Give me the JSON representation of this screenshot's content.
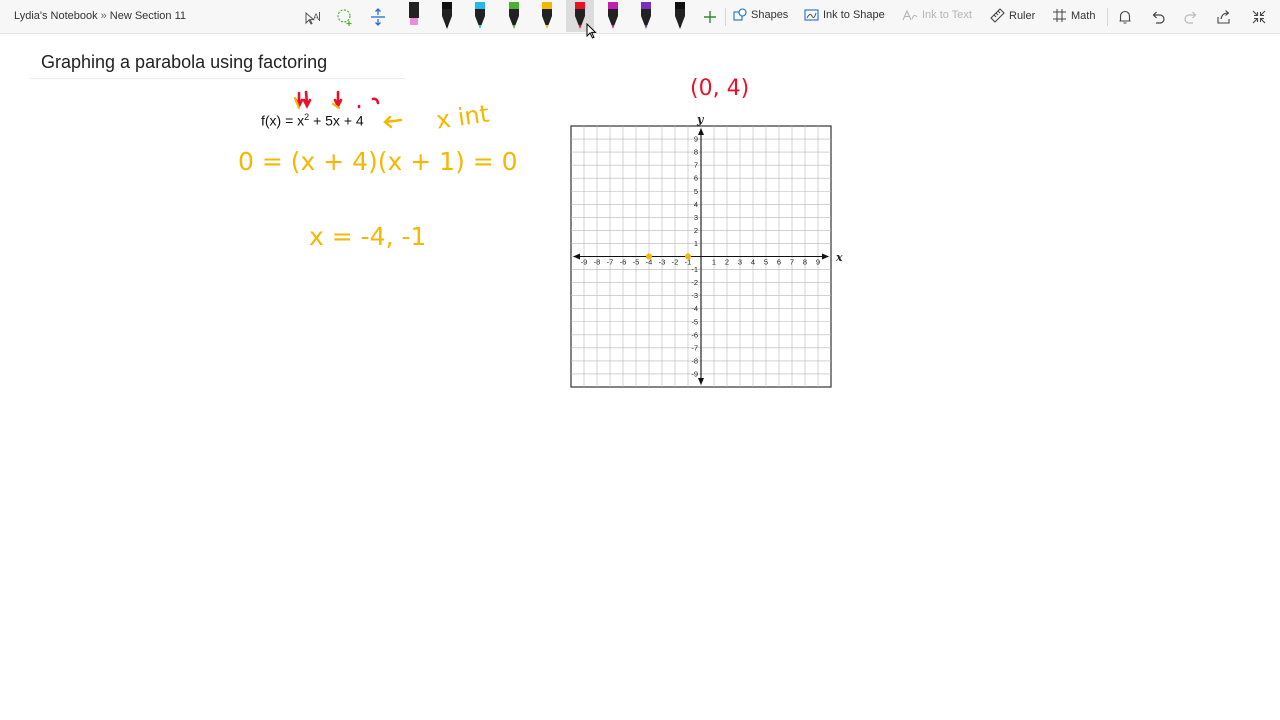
{
  "breadcrumb": {
    "notebook": "Lydia's Notebook",
    "separator": "»",
    "section": "New Section 11"
  },
  "toolbar": {
    "pens": [
      {
        "name": "pink-highlighter",
        "color": "#e98ed8"
      },
      {
        "name": "black-pen",
        "color": "#111111"
      },
      {
        "name": "cyan-pen",
        "color": "#27b7e8"
      },
      {
        "name": "green-pen",
        "color": "#4caf33"
      },
      {
        "name": "yellow-pen",
        "color": "#f2b705"
      },
      {
        "name": "red-pen",
        "color": "#e81123",
        "active": true
      },
      {
        "name": "magenta-pen",
        "color": "#c21fb0"
      },
      {
        "name": "purple-pen",
        "color": "#7b2fbf"
      },
      {
        "name": "black-pen-2",
        "color": "#111111"
      }
    ],
    "shapes_label": "Shapes",
    "ink_to_shape_label": "Ink to Shape",
    "ink_to_text_label": "Ink to Text",
    "ruler_label": "Ruler",
    "math_label": "Math"
  },
  "page": {
    "title": "Graphing a parabola using factoring",
    "equation": {
      "lhs": "f(x) = x",
      "exponent": "2",
      "rhs": " + 5x + 4"
    }
  },
  "ink": {
    "yellow": "#f5b700",
    "red": "#e8112d",
    "x_int_note": "x int",
    "factored_note": "0 = (x + 4)(x + 1) = 0",
    "roots_note": "x = -4, -1",
    "vertex_note": "(0, 4)"
  },
  "graph": {
    "x_axis_label": "x",
    "y_axis_label": "y",
    "x_ticks": [
      "-9",
      "-8",
      "-7",
      "-6",
      "-5",
      "-4",
      "-3",
      "-2",
      "-1",
      "1",
      "2",
      "3",
      "4",
      "5",
      "6",
      "7",
      "8",
      "9"
    ],
    "y_ticks": [
      "9",
      "8",
      "7",
      "6",
      "5",
      "4",
      "3",
      "2",
      "1",
      "-1",
      "-2",
      "-3",
      "-4",
      "-5",
      "-6",
      "-7",
      "-8",
      "-9"
    ],
    "plotted_points": [
      {
        "x": -4,
        "y": 0
      },
      {
        "x": -1,
        "y": 0
      }
    ]
  }
}
